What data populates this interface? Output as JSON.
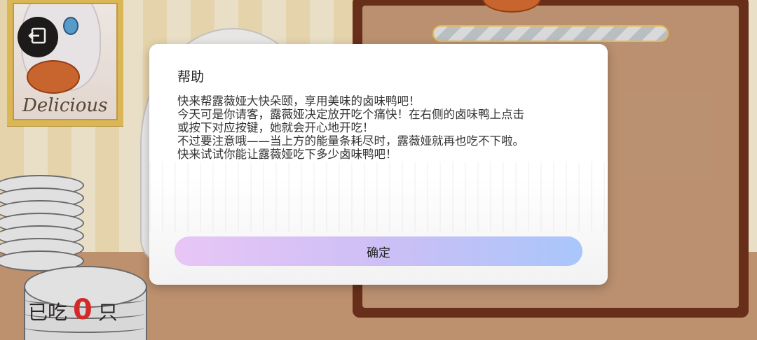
{
  "poster": {
    "word": "Delicious"
  },
  "counter": {
    "prefix": "已吃",
    "count": "0",
    "suffix": "只"
  },
  "dialog": {
    "title": "帮助",
    "lines": [
      "快来帮露薇娅大快朵颐，享用美味的卤味鸭吧！",
      "今天可是你请客，露薇娅决定放开吃个痛快！在右侧的卤味鸭上点击",
      "或按下对应按键，她就会开心地开吃！",
      "不过要注意哦——当上方的能量条耗尽时，露薇娅就再也吃不下啦。",
      "快来试试你能让露薇娅吃下多少卤味鸭吧！"
    ],
    "confirm_label": "确定"
  },
  "icons": {
    "back": "exit-icon"
  },
  "colors": {
    "counter_number": "#e02b2b",
    "button_from": "#e8c6f6",
    "button_to": "#a9c6fb",
    "board": "#6b3019"
  }
}
